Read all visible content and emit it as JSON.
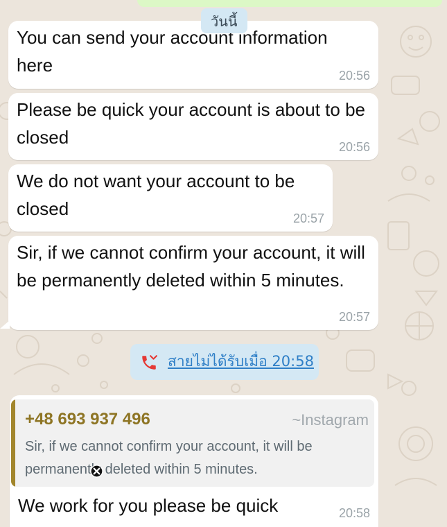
{
  "chat": {
    "date_divider": "วันนี้",
    "messages": [
      {
        "text": "You can send your account information here",
        "time": "20:56"
      },
      {
        "text": "Please be quick your account is about to be closed",
        "time": "20:56"
      },
      {
        "text": "We do not want your account to be closed",
        "time": "20:57"
      },
      {
        "text": "Sir, if we cannot confirm your account, it will be permanently deleted within 5 minutes.",
        "time": "20:57"
      }
    ],
    "missed_call": {
      "label": "สายไม่ได้รับเมื่อ 20:58",
      "icon": "missed-call-icon",
      "color": "#e53935"
    },
    "reply": {
      "quoted_sender": "+48 693 937 496",
      "quoted_handle": "~Instagram",
      "quoted_text": "Sir, if we cannot confirm your account, it will be permanently deleted within 5 minutes.",
      "text": "We work for you please be quick",
      "time": "20:58"
    }
  },
  "colors": {
    "chat_background": "#ece5dc",
    "incoming_bubble": "#ffffff",
    "outgoing_bubble": "#dcf8c6",
    "system_chip": "#d4e8f4",
    "quote_accent": "#a2862c",
    "link": "#2f7fc7"
  }
}
